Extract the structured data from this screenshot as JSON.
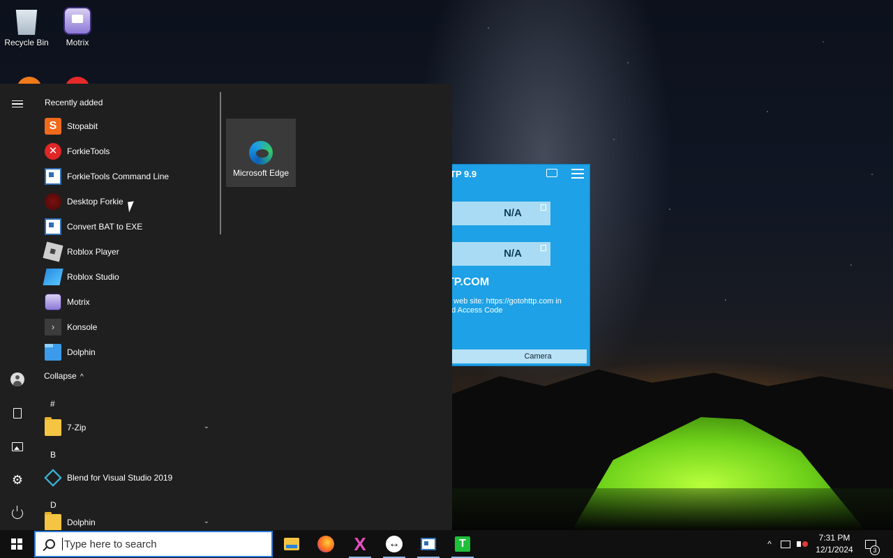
{
  "desktop": {
    "icons": [
      {
        "label": "Recycle Bin",
        "icon": "recycle-bin-icon"
      },
      {
        "label": "Motrix",
        "icon": "motrix-icon"
      }
    ]
  },
  "gotohttp_window": {
    "title": "TP 9.9",
    "computer_id": "N/A",
    "access_code": "N/A",
    "site": "TP.COM",
    "description": "e web site: https://gotohttp.com  in\nnd Access Code",
    "camera_label": "Camera"
  },
  "start_menu": {
    "section_title": "Recently added",
    "recent_apps": [
      {
        "label": "Stopabit",
        "icon": "stopabit-icon",
        "glyph": "S"
      },
      {
        "label": "ForkieTools",
        "icon": "forkietools-icon",
        "glyph": "✕"
      },
      {
        "label": "ForkieTools Command Line",
        "icon": "console-window-icon",
        "glyph": ""
      },
      {
        "label": "Desktop Forkie",
        "icon": "desktop-forkie-icon",
        "glyph": ""
      },
      {
        "label": "Convert BAT to EXE",
        "icon": "console-window-icon",
        "glyph": ""
      },
      {
        "label": "Roblox Player",
        "icon": "roblox-player-icon",
        "glyph": ""
      },
      {
        "label": "Roblox Studio",
        "icon": "roblox-studio-icon",
        "glyph": ""
      },
      {
        "label": "Motrix",
        "icon": "motrix-icon",
        "glyph": ""
      },
      {
        "label": "Konsole",
        "icon": "konsole-icon",
        "glyph": "›"
      },
      {
        "label": "Dolphin",
        "icon": "dolphin-icon",
        "glyph": ""
      }
    ],
    "collapse_label": "Collapse",
    "collapse_glyph": "^",
    "letter_hash": "#",
    "app_7zip": "7-Zip",
    "letter_b": "B",
    "app_blend": "Blend for Visual Studio 2019",
    "letter_d": "D",
    "app_dolphin_folder": "Dolphin",
    "expand_glyph": "⌄",
    "tile_label": "Microsoft Edge",
    "rail_icons": [
      "hamburger-menu-icon",
      "user-account-icon",
      "documents-icon",
      "pictures-icon",
      "settings-gear-icon",
      "power-icon"
    ],
    "gear_glyph": "⚙"
  },
  "taskbar": {
    "search_placeholder": "Type here to search",
    "pinned": [
      "file-explorer-icon",
      "firefox-icon",
      "x-app-icon",
      "teamviewer-icon",
      "console-window-icon",
      "t-app-icon"
    ],
    "x_glyph": "X",
    "t_glyph": "T",
    "tray_chevron": "^",
    "time": "7:31 PM",
    "date": "12/1/2024",
    "notification_count": "3"
  },
  "colors": {
    "start_bg": "#1f1f1f",
    "taskbar_bg": "#101010",
    "search_border": "#2b7bd8",
    "gotohttp_blue": "#1ea1e6"
  }
}
